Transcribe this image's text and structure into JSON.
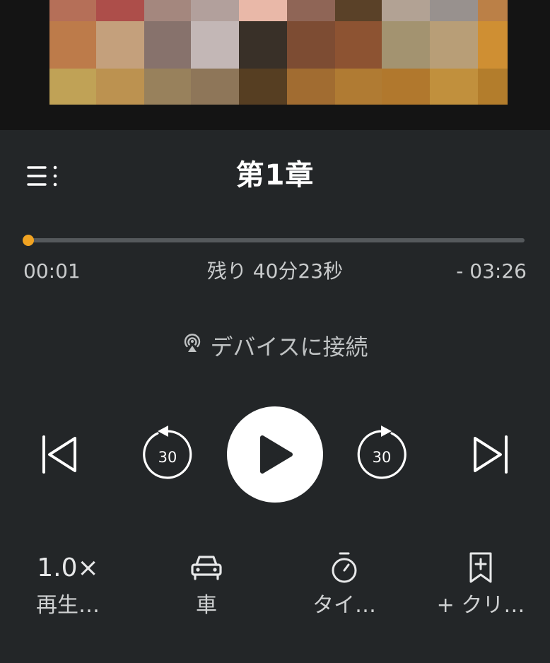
{
  "cover": {
    "colors": [
      [
        "#b56f58",
        "#ad4e4a",
        "#a4877e",
        "#b2a09c",
        "#e9b8a8",
        "#8f6556",
        "#5a4128",
        "#b2a294",
        "#98918e",
        "#bb8047"
      ],
      [
        "#bd7b4a",
        "#c4a07c",
        "#87726c",
        "#c3b7b6",
        "#393028",
        "#7d4c33",
        "#8d5332",
        "#a39370",
        "#b89e77",
        "#cf8f33"
      ],
      [
        "#c0a256",
        "#bc9250",
        "#98815c",
        "#8e7659",
        "#563e22",
        "#a16c31",
        "#b07b33",
        "#b1782d",
        "#c1903d",
        "#b37d2c"
      ]
    ]
  },
  "header": {
    "title": "第1章",
    "menu_icon": "chapter-list-icon"
  },
  "progress": {
    "elapsed": "00:01",
    "remaining_total": "残り 40分23秒",
    "remaining_chapter": "- 03:26",
    "fraction": 0.003,
    "accent_color": "#f0a322"
  },
  "connect": {
    "label": "デバイスに接続",
    "icon": "cast-device-icon"
  },
  "controls": {
    "prev_icon": "skip-previous-icon",
    "rewind_label": "30",
    "play_icon": "play-icon",
    "forward_label": "30",
    "next_icon": "skip-next-icon"
  },
  "bottom": {
    "speed_value": "1.0×",
    "speed_label": "再生…",
    "car_label": "車",
    "timer_label": "タイ…",
    "clip_label": "+ クリ…"
  }
}
